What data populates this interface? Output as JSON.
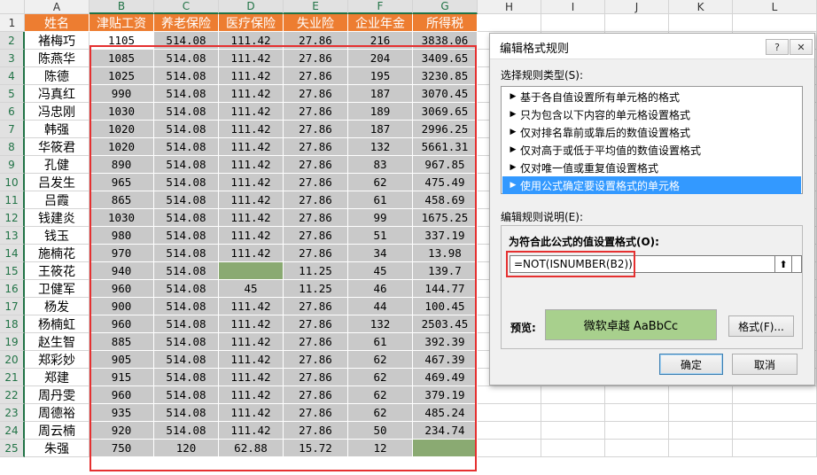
{
  "columns": [
    "A",
    "B",
    "C",
    "D",
    "E",
    "F",
    "G",
    "H",
    "I",
    "J",
    "K",
    "L"
  ],
  "selected_columns": [
    "B",
    "C",
    "D",
    "E",
    "F",
    "G"
  ],
  "header_row": [
    "姓名",
    "津贴工资",
    "养老保险",
    "医疗保险",
    "失业险",
    "企业年金",
    "所得税"
  ],
  "rows": [
    [
      "2",
      "褚梅巧",
      "1105",
      "514.08",
      "111.42",
      "27.86",
      "216",
      "3838.06"
    ],
    [
      "3",
      "陈燕华",
      "1085",
      "514.08",
      "111.42",
      "27.86",
      "204",
      "3409.65"
    ],
    [
      "4",
      "陈德",
      "1025",
      "514.08",
      "111.42",
      "27.86",
      "195",
      "3230.85"
    ],
    [
      "5",
      "冯真红",
      "990",
      "514.08",
      "111.42",
      "27.86",
      "187",
      "3070.45"
    ],
    [
      "6",
      "冯忠刚",
      "1030",
      "514.08",
      "111.42",
      "27.86",
      "189",
      "3069.65"
    ],
    [
      "7",
      "韩强",
      "1020",
      "514.08",
      "111.42",
      "27.86",
      "187",
      "2996.25"
    ],
    [
      "8",
      "华筱君",
      "1020",
      "514.08",
      "111.42",
      "27.86",
      "132",
      "5661.31"
    ],
    [
      "9",
      "孔健",
      "890",
      "514.08",
      "111.42",
      "27.86",
      "83",
      "967.85"
    ],
    [
      "10",
      "吕发生",
      "965",
      "514.08",
      "111.42",
      "27.86",
      "62",
      "475.49"
    ],
    [
      "11",
      "吕霞",
      "865",
      "514.08",
      "111.42",
      "27.86",
      "61",
      "458.69"
    ],
    [
      "12",
      "钱建炎",
      "1030",
      "514.08",
      "111.42",
      "27.86",
      "99",
      "1675.25"
    ],
    [
      "13",
      "钱玉",
      "980",
      "514.08",
      "111.42",
      "27.86",
      "51",
      "337.19"
    ],
    [
      "14",
      "施楠花",
      "970",
      "514.08",
      "111.42",
      "27.86",
      "34",
      "13.98"
    ],
    [
      "15",
      "王筱花",
      "940",
      "514.08",
      "",
      "11.25",
      "45",
      "139.7"
    ],
    [
      "16",
      "卫健军",
      "960",
      "514.08",
      "45",
      "11.25",
      "46",
      "144.77"
    ],
    [
      "17",
      "杨发",
      "900",
      "514.08",
      "111.42",
      "27.86",
      "44",
      "100.45"
    ],
    [
      "18",
      "杨楠虹",
      "960",
      "514.08",
      "111.42",
      "27.86",
      "132",
      "2503.45"
    ],
    [
      "19",
      "赵生智",
      "885",
      "514.08",
      "111.42",
      "27.86",
      "61",
      "392.39"
    ],
    [
      "20",
      "郑彩妙",
      "905",
      "514.08",
      "111.42",
      "27.86",
      "62",
      "467.39"
    ],
    [
      "21",
      "郑建",
      "915",
      "514.08",
      "111.42",
      "27.86",
      "62",
      "469.49"
    ],
    [
      "22",
      "周丹雯",
      "960",
      "514.08",
      "111.42",
      "27.86",
      "62",
      "379.19"
    ],
    [
      "23",
      "周德裕",
      "935",
      "514.08",
      "111.42",
      "27.86",
      "62",
      "485.24"
    ],
    [
      "24",
      "周云楠",
      "920",
      "514.08",
      "111.42",
      "27.86",
      "50",
      "234.74"
    ],
    [
      "25",
      "朱强",
      "750",
      "120",
      "62.88",
      "15.72",
      "12",
      ""
    ]
  ],
  "dialog": {
    "title": "编辑格式规则",
    "help_button": "?",
    "close_button": "✕",
    "select_type_label": "选择规则类型(S):",
    "rule_types": [
      "基于各自值设置所有单元格的格式",
      "只为包含以下内容的单元格设置格式",
      "仅对排名靠前或靠后的数值设置格式",
      "仅对高于或低于平均值的数值设置格式",
      "仅对唯一值或重复值设置格式",
      "使用公式确定要设置格式的单元格"
    ],
    "selected_rule_type": "使用公式确定要设置格式的单元格",
    "edit_desc_label": "编辑规则说明(E):",
    "formula_label": "为符合此公式的值设置格式(O):",
    "formula": "=NOT(ISNUMBER(B2))",
    "preview_label": "预览:",
    "preview_text": "微软卓越  AaBbCc",
    "format_button": "格式(F)...",
    "ok_button": "确定",
    "cancel_button": "取消"
  },
  "colors": {
    "header_fill": "#ed7d31",
    "cell_gray": "#c9c9c9",
    "format_green": "#8aaa72",
    "preview_green": "#a8d08d",
    "highlight_red": "#e53030",
    "selection_blue": "#3399ff"
  }
}
